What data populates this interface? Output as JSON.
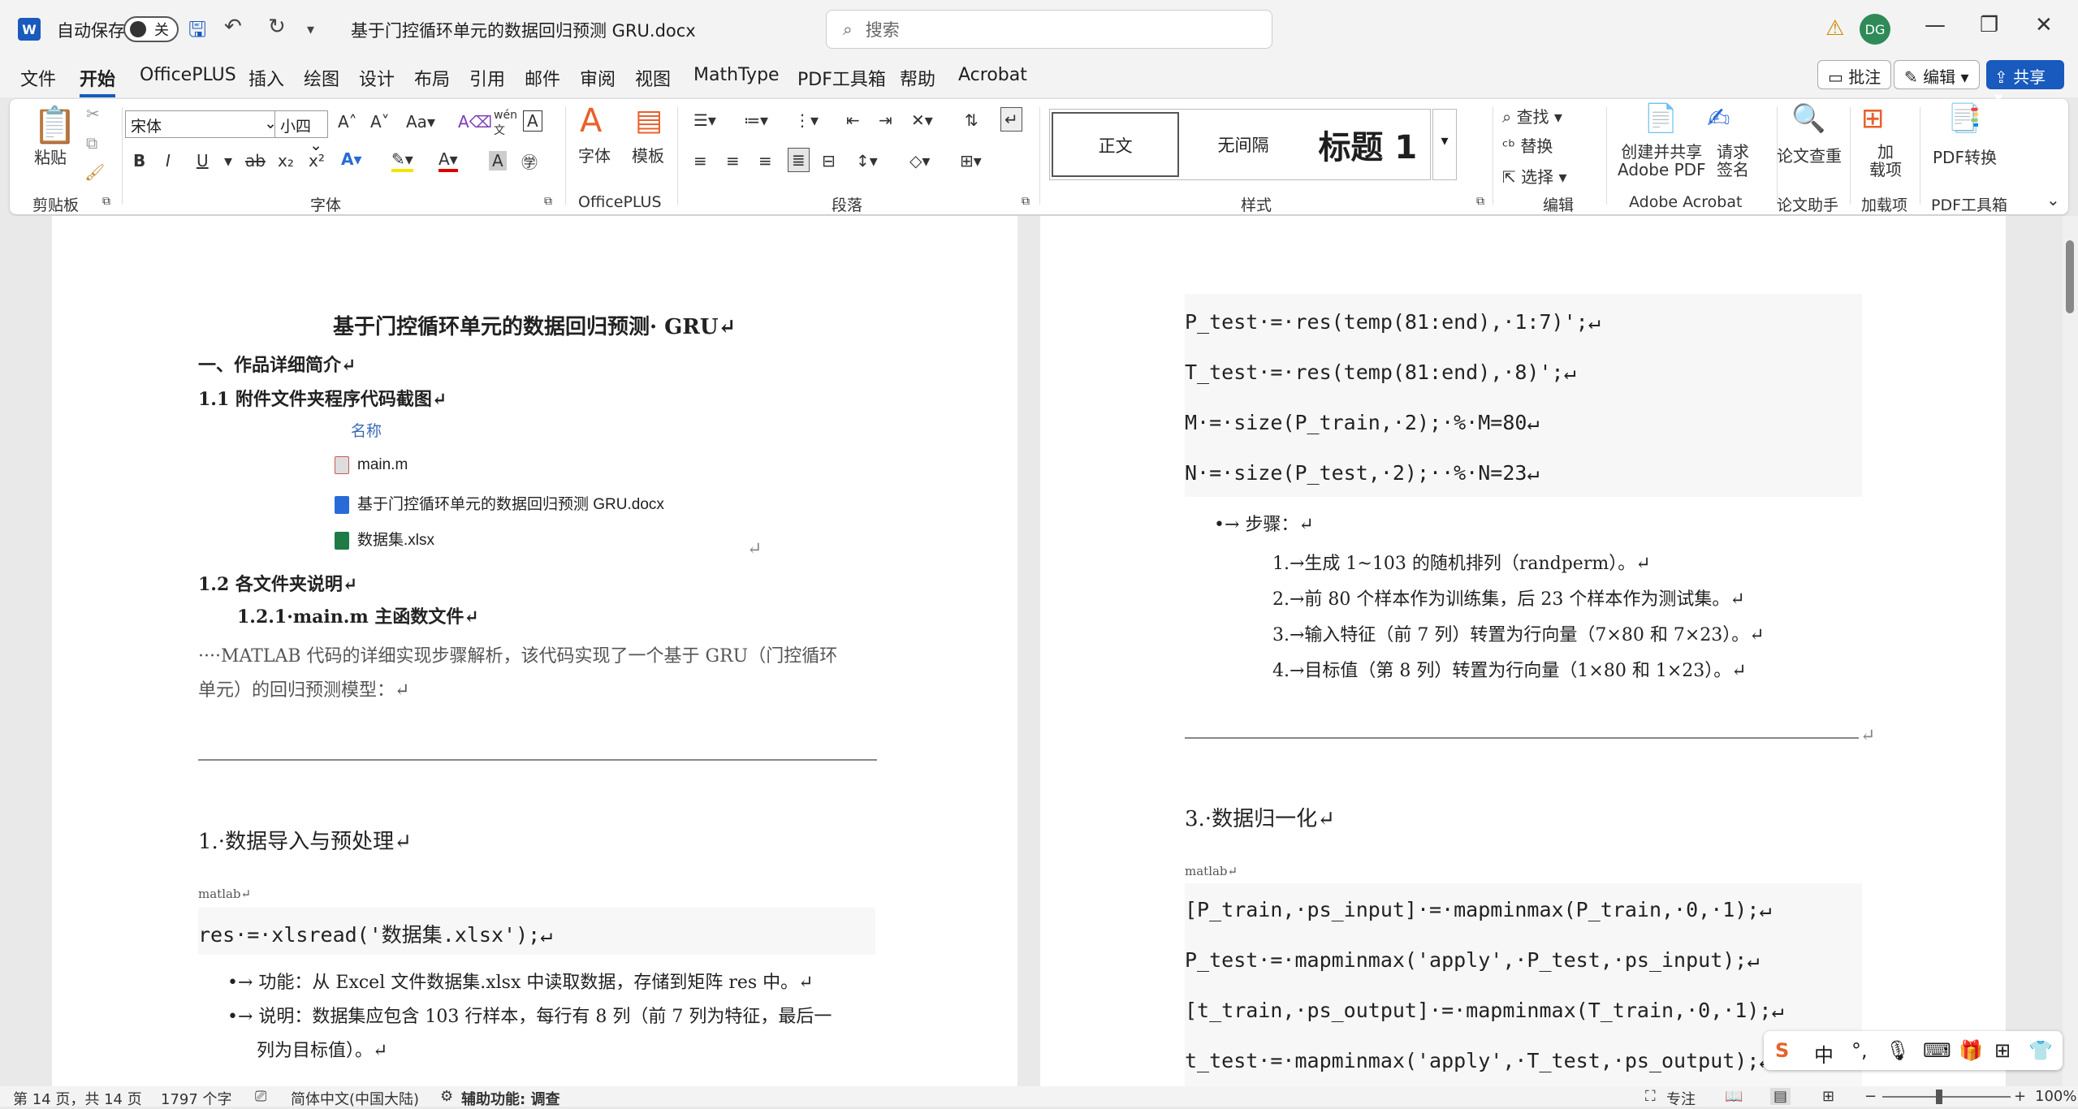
{
  "titlebar": {
    "autosave_label": "自动保存",
    "autosave_state": "关",
    "doc_title": "基于门控循环单元的数据回归预测 GRU.docx",
    "search_placeholder": "搜索",
    "avatar": "DG"
  },
  "menu": {
    "tabs": [
      "文件",
      "开始",
      "OfficePLUS",
      "插入",
      "绘图",
      "设计",
      "布局",
      "引用",
      "邮件",
      "审阅",
      "视图",
      "MathType",
      "PDF工具箱",
      "帮助",
      "Acrobat"
    ],
    "comment_btn": "批注",
    "edit_btn": "编辑",
    "share_btn": "共享"
  },
  "ribbon": {
    "paste": "粘贴",
    "font_name": "宋体",
    "font_size": "小四",
    "style_normal": "正文",
    "style_nospace": "无间隔",
    "style_h1": "标题 1",
    "find": "查找",
    "replace": "替换",
    "select": "选择",
    "font_btn": "字体",
    "template_btn": "模板",
    "create_share_pdf_1": "创建并共享",
    "create_share_pdf_2": "Adobe PDF",
    "request_sign_1": "请求",
    "request_sign_2": "签名",
    "paper_check": "论文查重",
    "addins_1": "加",
    "addins_2": "载项",
    "pdf_convert": "PDF转换",
    "groups": {
      "clipboard": "剪贴板",
      "font": "字体",
      "officeplus": "OfficePLUS",
      "paragraph": "段落",
      "styles": "样式",
      "editing": "编辑",
      "acrobat": "Adobe Acrobat",
      "paper": "论文助手",
      "addins": "加载项",
      "pdftools": "PDF工具箱"
    }
  },
  "page1": {
    "title": "基于门控循环单元的数据回归预测· GRU↵",
    "h1": "一、作品详细简介↵",
    "h11": "1.1 附件文件夹程序代码截图↵",
    "col_name": "名称",
    "files": [
      "main.m",
      "基于门控循环单元的数据回归预测 GRU.docx",
      "数据集.xlsx"
    ],
    "ret_mark": "↵",
    "h12": "1.2 各文件夹说明↵",
    "h121": "1.2.1·main.m 主函数文件↵",
    "para1": "····MATLAB 代码的详细实现步骤解析，该代码实现了一个基于 GRU（门控循环",
    "para2": "单元）的回归预测模型：↵",
    "sec1": "1.·数据导入与预处理↵",
    "lang": "matlab↵",
    "code": "res·=·xlsread('数据集.xlsx');↵",
    "b1": "•→ 功能：从 Excel 文件数据集.xlsx 中读取数据，存储到矩阵 res 中。↵",
    "b2a": "•→ 说明：数据集应包含 103 行样本，每行有 8 列（前 7 列为特征，最后一",
    "b2b": "列为目标值）。↵"
  },
  "page2": {
    "c1": "P_test·=·res(temp(81:end),·1:7)';↵",
    "c2": "T_test·=·res(temp(81:end),·8)';↵",
    "c3": "M·=·size(P_train,·2);·%·M=80↵",
    "c4": "N·=·size(P_test,·2);··%·N=23↵",
    "steps_label": "•→ 步骤：↵",
    "steps": [
      "1.→生成 1~103 的随机排列（randperm）。↵",
      "2.→前 80 个样本作为训练集，后 23 个样本作为测试集。↵",
      "3.→输入特征（前 7 列）转置为行向量（7×80 和 7×23）。↵",
      "4.→目标值（第 8 列）转置为行向量（1×80 和 1×23）。↵"
    ],
    "ret_mark": "↵",
    "sec3": "3.·数据归一化↵",
    "lang": "matlab↵",
    "n1": "[P_train,·ps_input]·=·mapminmax(P_train,·0,·1);↵",
    "n2": "P_test·=·mapminmax('apply',·P_test,·ps_input);↵",
    "n3": "[t_train,·ps_output]·=·mapminmax(T_train,·0,·1);↵",
    "n4": "t_test·=·mapminmax('apply',·T_test,·ps_output);↵"
  },
  "status": {
    "page": "第 14 页，共 14 页",
    "words": "1797 个字",
    "lang": "简体中文(中国大陆)",
    "access": "辅助功能: 调查",
    "focus": "专注",
    "zoom": "100%"
  },
  "ime": {
    "zh": "中"
  },
  "colors": {
    "accent": "#185abd",
    "page": "#ffffff",
    "canvas": "#e9e9e9"
  }
}
